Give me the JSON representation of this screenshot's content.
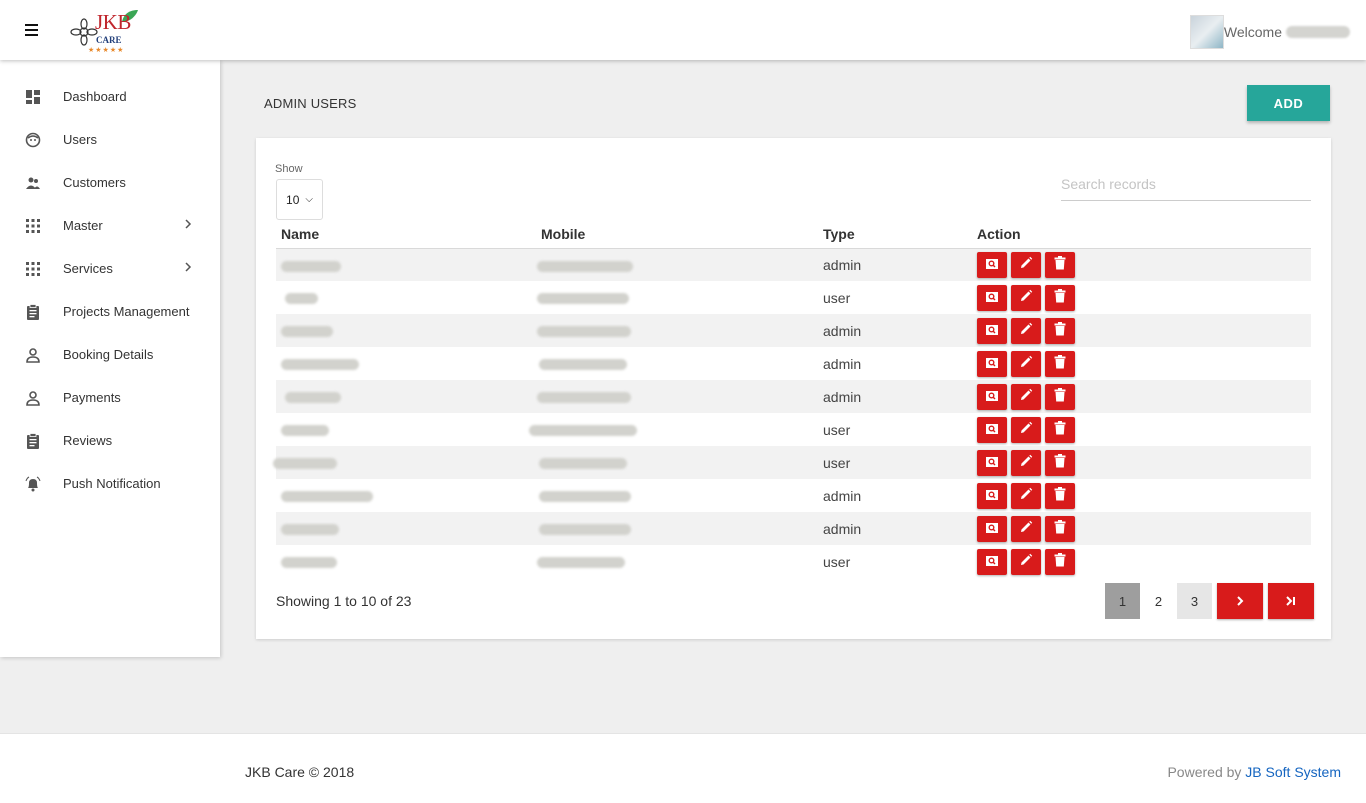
{
  "header": {
    "logo_text": "JKB",
    "logo_sub": "CARE",
    "logo_stars": "★★★★★",
    "welcome": "Welcome"
  },
  "sidebar": {
    "items": [
      {
        "label": "Dashboard",
        "icon": "dashboard-icon",
        "chevron": false
      },
      {
        "label": "Users",
        "icon": "face-icon",
        "chevron": false
      },
      {
        "label": "Customers",
        "icon": "people-icon",
        "chevron": false
      },
      {
        "label": "Master",
        "icon": "grid-icon",
        "chevron": true
      },
      {
        "label": "Services",
        "icon": "grid-icon",
        "chevron": true
      },
      {
        "label": "Projects Management",
        "icon": "clipboard-icon",
        "chevron": false
      },
      {
        "label": "Booking Details",
        "icon": "person-icon",
        "chevron": false
      },
      {
        "label": "Payments",
        "icon": "person-icon",
        "chevron": false
      },
      {
        "label": "Reviews",
        "icon": "clipboard-icon",
        "chevron": false
      },
      {
        "label": "Push Notification",
        "icon": "bell-icon",
        "chevron": false
      }
    ]
  },
  "main": {
    "title": "ADMIN USERS",
    "add_label": "ADD",
    "show_label": "Show",
    "show_value": "10",
    "search_placeholder": "Search records",
    "columns": [
      "Name",
      "Mobile",
      "Type",
      "Action"
    ],
    "rows": [
      {
        "type": "admin"
      },
      {
        "type": "user"
      },
      {
        "type": "admin"
      },
      {
        "type": "admin"
      },
      {
        "type": "admin"
      },
      {
        "type": "user"
      },
      {
        "type": "user"
      },
      {
        "type": "admin"
      },
      {
        "type": "admin"
      },
      {
        "type": "user"
      }
    ],
    "showing": "Showing 1 to 10 of 23",
    "pages": [
      "1",
      "2",
      "3"
    ],
    "current_page": "1"
  },
  "footer": {
    "copyright": "JKB Care © 2018",
    "powered_prefix": "Powered by",
    "powered_link": "JB Soft System"
  },
  "colors": {
    "accent": "#26a69a",
    "action_red": "#d81b1b",
    "link_blue": "#1565c0"
  }
}
